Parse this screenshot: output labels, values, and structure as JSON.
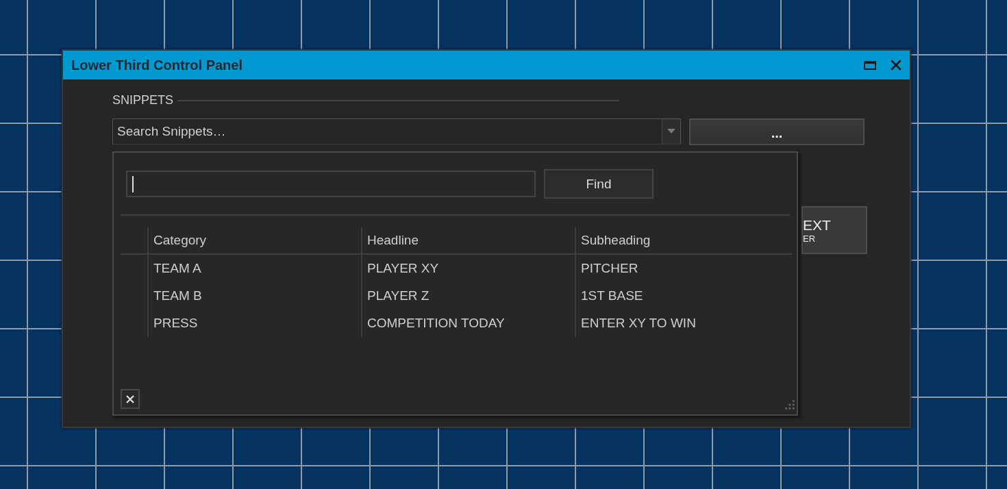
{
  "window": {
    "title": "Lower Third Control Panel"
  },
  "snippets": {
    "label": "SNIPPETS",
    "combo": {
      "placeholder": "Search Snippets…",
      "expanded": true
    },
    "more_button": "..."
  },
  "partial_button": {
    "label": "EXT",
    "sublabel": "ER"
  },
  "popup": {
    "search": {
      "focused": true
    },
    "find_button": "Find",
    "columns": [
      "Category",
      "Headline",
      "Subheading"
    ],
    "rows": [
      [
        "TEAM A",
        "PLAYER XY",
        "PITCHER"
      ],
      [
        "TEAM B",
        "PLAYER Z",
        "1ST BASE"
      ],
      [
        "PRESS",
        "COMPETITION TODAY",
        "ENTER XY TO WIN"
      ]
    ]
  }
}
